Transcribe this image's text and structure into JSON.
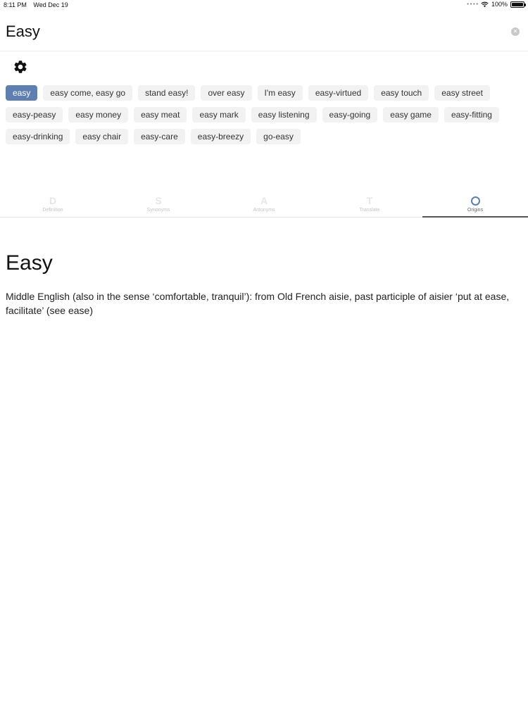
{
  "status": {
    "time": "8:11 PM",
    "date": "Wed Dec 19",
    "battery": "100%",
    "battery_level": 1.0
  },
  "search": {
    "value": "Easy"
  },
  "chips": [
    "easy",
    "easy come, easy go",
    "stand easy!",
    "over easy",
    "I'm easy",
    "easy-virtued",
    "easy touch",
    "easy street",
    "easy-peasy",
    "easy money",
    "easy meat",
    "easy mark",
    "easy listening",
    "easy-going",
    "easy game",
    "easy-fitting",
    "easy-drinking",
    "easy chair",
    "easy-care",
    "easy-breezy",
    "go-easy"
  ],
  "selected_chip": "easy",
  "tabs": [
    {
      "label": "Definition",
      "icon": "D"
    },
    {
      "label": "Synonyms",
      "icon": "S"
    },
    {
      "label": "Antonyms",
      "icon": "A"
    },
    {
      "label": "Translate",
      "icon": "T"
    },
    {
      "label": "Origins",
      "icon": "origins-ring-icon"
    }
  ],
  "active_tab": "Origins",
  "content": {
    "title": "Easy",
    "body": "Middle English (also in the sense ‘comfortable, tranquil’): from Old French aisie, past participle of aisier ‘put at ease, facilitate’ (see ease)"
  },
  "colors": {
    "accent": "#5e7fb0",
    "chip_bg": "#f2f2f2"
  }
}
